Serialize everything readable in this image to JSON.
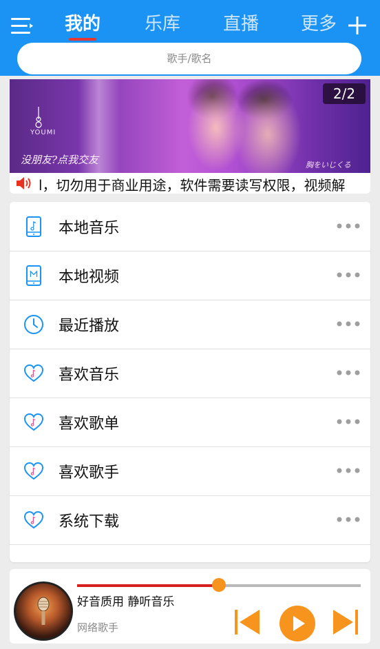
{
  "header": {
    "tabs": [
      {
        "label": "我的",
        "active": true
      },
      {
        "label": "乐库",
        "active": false
      },
      {
        "label": "直播",
        "active": false
      },
      {
        "label": "更多",
        "active": false
      }
    ],
    "menu_icon": "hamburger-menu-icon",
    "add_icon": "plus-icon",
    "accent_color": "#1a93f5",
    "tab_indicator_color": "#e53935"
  },
  "search": {
    "placeholder": "歌手/歌名"
  },
  "banner": {
    "brand": "YOUMI",
    "slogan": "没朋友?点我交友",
    "signature": "胸をいじくる",
    "page_counter": "2/2"
  },
  "notice": {
    "icon": "speaker-icon",
    "text": "l，切勿用于商业用途，软件需要读写权限，视频解"
  },
  "menu": {
    "items": [
      {
        "label": "本地音乐",
        "icon": "phone-music-icon"
      },
      {
        "label": "本地视频",
        "icon": "phone-video-icon"
      },
      {
        "label": "最近播放",
        "icon": "clock-icon"
      },
      {
        "label": "喜欢音乐",
        "icon": "heart-music-icon"
      },
      {
        "label": "喜欢歌单",
        "icon": "heart-music-icon"
      },
      {
        "label": "喜欢歌手",
        "icon": "heart-music-icon"
      },
      {
        "label": "系统下载",
        "icon": "heart-music-icon"
      }
    ],
    "more_icon": "more-dots-icon"
  },
  "player": {
    "song_title": "好音质用 静听音乐",
    "artist": "网络歌手",
    "progress": 0.5,
    "progress_color": "#d62020",
    "control_color": "#f7941d"
  }
}
